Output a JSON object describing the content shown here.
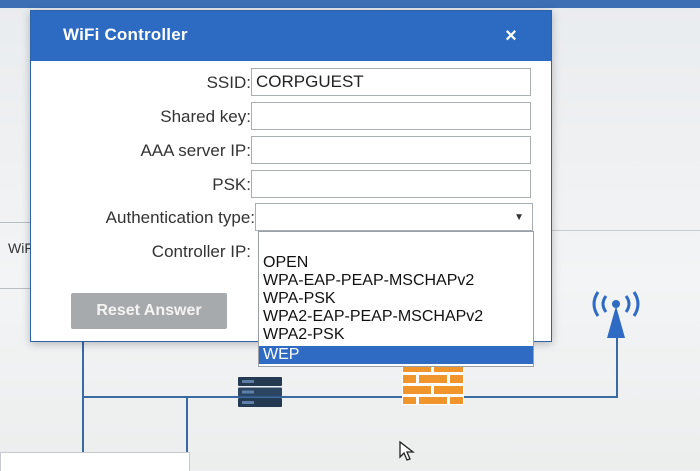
{
  "dialog": {
    "title": "WiFi Controller",
    "close_glyph": "×",
    "fields": {
      "ssid_label": "SSID:",
      "ssid_value": "CORPGUEST",
      "shared_key_label": "Shared key:",
      "shared_key_value": "",
      "aaa_label": "AAA server IP:",
      "aaa_value": "",
      "psk_label": "PSK:",
      "psk_value": "",
      "auth_label": "Authentication type:",
      "auth_value": "",
      "controller_label": "Controller IP:"
    },
    "reset_label": "Reset Answer"
  },
  "dropdown": {
    "options": [
      "OPEN",
      "WPA-EAP-PEAP-MSCHAPv2",
      "WPA-PSK",
      "WPA2-EAP-PEAP-MSCHAPv2",
      "WPA2-PSK",
      "WEP"
    ],
    "highlighted": "WEP"
  },
  "background": {
    "wifi_label": "WiF"
  },
  "icons": {
    "server": "server-icon",
    "firewall": "firewall-icon",
    "antenna": "wireless-antenna-icon",
    "cursor": "mouse-pointer-icon",
    "dropdown_arrow": "chevron-down-icon",
    "close": "close-icon"
  },
  "colors": {
    "header_blue": "#2d6ac1",
    "selection_blue": "#2f6ac3",
    "firewall_orange": "#f0942c",
    "network_line": "#3a6aa2"
  }
}
